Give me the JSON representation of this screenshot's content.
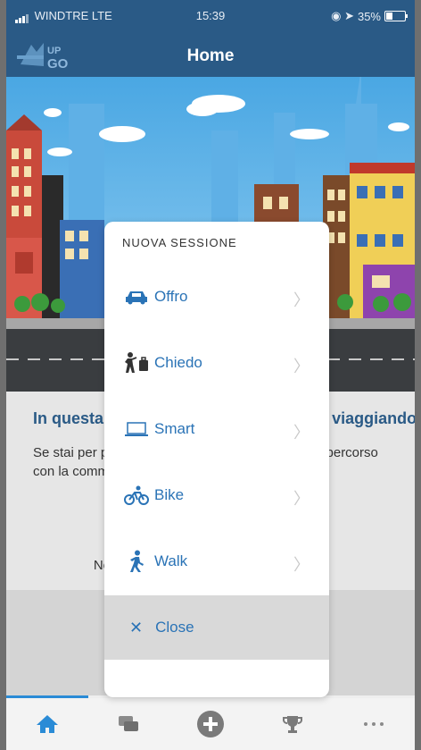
{
  "status_bar": {
    "carrier": "WINDTRE  LTE",
    "time": "15:39",
    "battery": "35%"
  },
  "header": {
    "title": "Home",
    "logo_text_top": "UP",
    "logo_text_bottom": "GO"
  },
  "content": {
    "title": "In questa sezione potrai vedere chi sta viaggiando",
    "text": "Se stai per partire o sei in viaggio, condividi il tuo percorso con la community e rendilo visibile agli altri",
    "note": "Nessun viaggio disponibile al momento."
  },
  "modal": {
    "title": "NUOVA SESSIONE",
    "items": [
      {
        "label": "Offro",
        "icon": "car-icon"
      },
      {
        "label": "Chiedo",
        "icon": "hitchhiker-icon"
      },
      {
        "label": "Smart",
        "icon": "laptop-icon"
      },
      {
        "label": "Bike",
        "icon": "bike-icon"
      },
      {
        "label": "Walk",
        "icon": "walk-icon"
      }
    ],
    "close_label": "Close"
  },
  "tabbar": [
    "home-icon",
    "chat-icon",
    "add-icon",
    "trophy-icon",
    "more-icon"
  ],
  "colors": {
    "header": "#2a5a86",
    "accent": "#2a73b6",
    "active_tab": "#2a8bd6"
  }
}
